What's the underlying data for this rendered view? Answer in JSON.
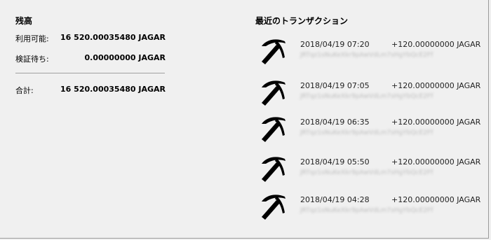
{
  "balance": {
    "title": "残高",
    "rows": [
      {
        "label": "利用可能:",
        "value": "16 520.00035480  JAGAR"
      },
      {
        "label": "検証待ち:",
        "value": "0.00000000  JAGAR"
      }
    ],
    "total": {
      "label": "合計:",
      "value": "16 520.00035480  JAGAR"
    }
  },
  "transactions": {
    "title": "最近のトランザクション",
    "icon": "pickaxe-icon",
    "items": [
      {
        "date": "2018/04/19 07:20",
        "amount": "+120.00000000  JAGAR",
        "address": "JRTqz1sNuKeXkr9pAwVdLm7sHgYbQcE2Ff"
      },
      {
        "date": "2018/04/19 07:05",
        "amount": "+120.00000000  JAGAR",
        "address": "JRTqz1sNuKeXkr9pAwVdLm7sHgYbQcE2Ff"
      },
      {
        "date": "2018/04/19 06:35",
        "amount": "+120.00000000  JAGAR",
        "address": "JRTqz1sNuKeXkr9pAwVdLm7sHgYbQcE2Ff"
      },
      {
        "date": "2018/04/19 05:50",
        "amount": "+120.00000000  JAGAR",
        "address": "JRTqz1sNuKeXkr9pAwVdLm7sHgYbQcE2Ff"
      },
      {
        "date": "2018/04/19 04:28",
        "amount": "+120.00000000  JAGAR",
        "address": "JRTqz1sNuKeXkr9pAwVdLm7sHgYbQcE2Ff"
      }
    ]
  }
}
